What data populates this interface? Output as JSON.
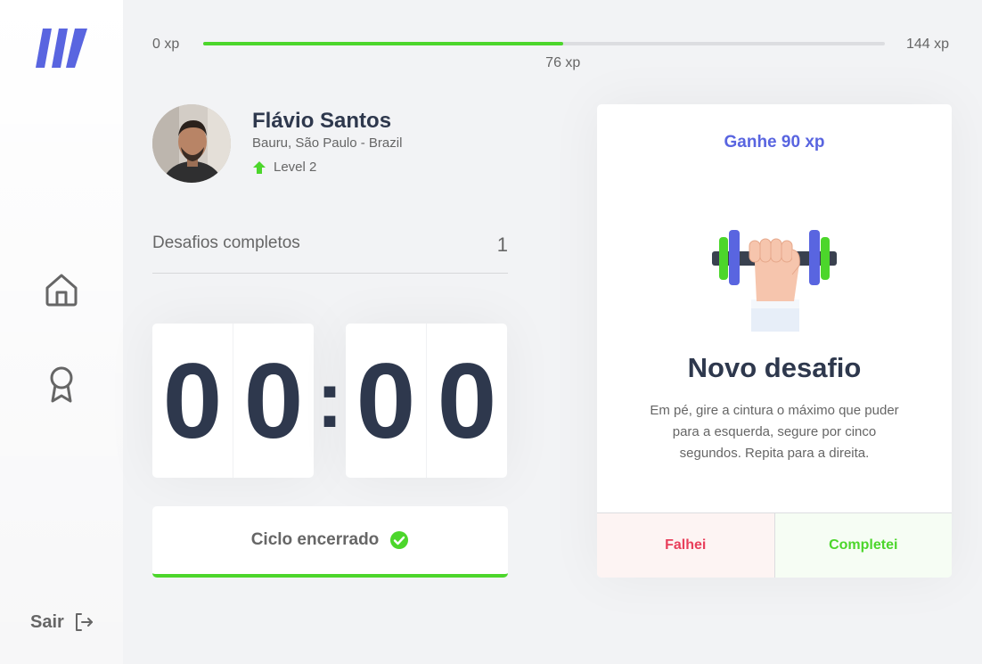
{
  "xp": {
    "min_label": "0 xp",
    "max_label": "144 xp",
    "current_label": "76 xp",
    "current": 76,
    "max": 144
  },
  "profile": {
    "name": "Flávio Santos",
    "location": "Bauru, São Paulo - Brazil",
    "level_label": "Level 2"
  },
  "completed": {
    "label": "Desafios completos",
    "count": "1"
  },
  "countdown": {
    "minute_left": "0",
    "minute_right": "0",
    "separator": ":",
    "second_left": "0",
    "second_right": "0"
  },
  "cycle": {
    "label": "Ciclo encerrado"
  },
  "challenge": {
    "header": "Ganhe 90 xp",
    "title": "Novo desafio",
    "description": "Em pé, gire a cintura o máximo que puder para a esquerda, segure por cinco segundos. Repita para a direita.",
    "fail_label": "Falhei",
    "done_label": "Completei"
  },
  "sidebar": {
    "logout_label": "Sair",
    "icons": [
      "logo-icon",
      "home-icon",
      "award-icon",
      "logout-icon"
    ]
  },
  "colors": {
    "accent": "#5965e0",
    "green": "#4cd62b",
    "red": "#e83f5b",
    "title": "#2e384d",
    "text": "#666666",
    "background": "#f2f3f5"
  }
}
